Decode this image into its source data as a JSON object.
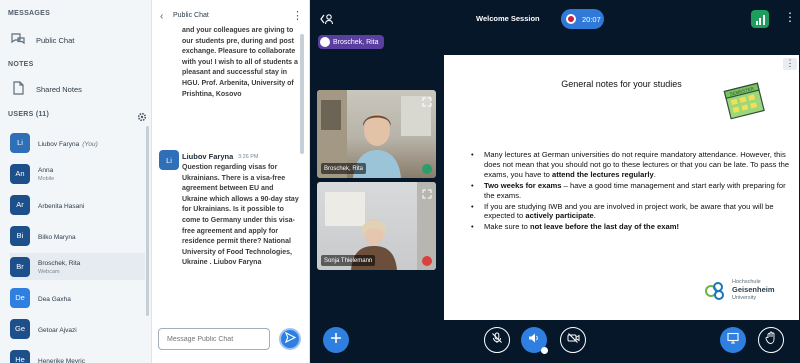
{
  "sidebar": {
    "messages_heading": "MESSAGES",
    "public_chat_label": "Public Chat",
    "notes_heading": "NOTES",
    "shared_notes_label": "Shared Notes",
    "users_heading": "USERS (11)",
    "users": [
      {
        "initials": "Li",
        "name": "Liubov Faryna",
        "suffix": "(You)",
        "color": "#2e6fb7",
        "badge": "#d94040"
      },
      {
        "initials": "An",
        "name": "Anna",
        "sub": "Mobile",
        "color": "#1d4f8a",
        "badge": "#d94040"
      },
      {
        "initials": "Ar",
        "name": "Arbenita Hasani",
        "color": "#1d4f8a",
        "badge": "#2a9d6a"
      },
      {
        "initials": "Bi",
        "name": "Bilko Maryna",
        "color": "#1d4f8a",
        "badge": "#d94040"
      },
      {
        "initials": "Br",
        "name": "Broschek, Rita",
        "sub": "Webcam",
        "color": "#1d4f8a",
        "badge": "#2a9d6a"
      },
      {
        "initials": "De",
        "name": "Dea Gaxha",
        "color": "#2e7fe0",
        "badge": ""
      },
      {
        "initials": "Ge",
        "name": "Getoar Ajvazi",
        "color": "#1d4f8a",
        "badge": "#2a9d6a"
      },
      {
        "initials": "He",
        "name": "Henerike Mevric",
        "color": "#1d4f8a",
        "badge": ""
      }
    ]
  },
  "chat": {
    "title": "Public Chat",
    "message_top": "and your colleagues are giving to our students pre, during and post exchange. Pleasure to collaborate with you! I wish to all of students a pleasant and successful stay in HGU. Prof. Arbenita, University of Prishtina, Kosovo",
    "sender_initials": "Li",
    "sender_name": "Liubov Faryna",
    "time": "3:26 PM",
    "message_bottom": "Question regarding visas for Ukrainians. There is a visa-free agreement between EU and Ukraine which allows a 90-day stay for Ukrainians. Is it possible to come to Germany under this visa-free agreement and apply for residence permit there? National University of Food Technologies, Ukraine . Liubov Faryna",
    "input_placeholder": "Message Public Chat"
  },
  "main": {
    "session_title": "Welcome Session",
    "recording_time": "20:07",
    "presenter": "Broschek, Rita",
    "videos": [
      {
        "name": "Broschek, Rita",
        "mic": "#2a9d6a"
      },
      {
        "name": "Sonja Thielemann",
        "mic": "#d94040"
      }
    ]
  },
  "slide": {
    "title": "General notes for your studies",
    "b1_pre": "Many lectures at German universities do not require mandatory attendance. However, this does not mean that you should not go to these lectures or that you can be late. To pass the exams, you have to ",
    "b1_bold": "attend the lectures regularly",
    "b1_post": ".",
    "b2_bold": "Two weeks for exams",
    "b2_post": " – have a good time management and start early with preparing for the exams.",
    "b3_pre": "If you are studying IWB and you are involved in project work, be aware that you will be expected to ",
    "b3_bold": "actively participate",
    "b3_post": ".",
    "b4_pre": "Make sure to ",
    "b4_bold": "not leave before the last day of the exam!",
    "logo_line1": "Hochschule",
    "logo_line2": "Geisenheim",
    "logo_line3": "University",
    "sticker_text": "SEMESTER"
  },
  "colors": {
    "accent": "#2e7fe0",
    "dark_bg": "#06172a",
    "record": "#d11c3d",
    "presenter_tag": "#5a3ea0",
    "connection": "#1e9e5c"
  },
  "icons": [
    "chat-bubbles-icon",
    "notes-icon",
    "gear-icon",
    "chevron-left-icon",
    "more-vertical-icon",
    "send-icon",
    "user-list-icon",
    "record-icon",
    "signal-icon",
    "expand-icon",
    "microphone-icon",
    "plus-icon",
    "mic-off-icon",
    "speaker-icon",
    "camera-off-icon",
    "presentation-icon",
    "raise-hand-icon"
  ]
}
